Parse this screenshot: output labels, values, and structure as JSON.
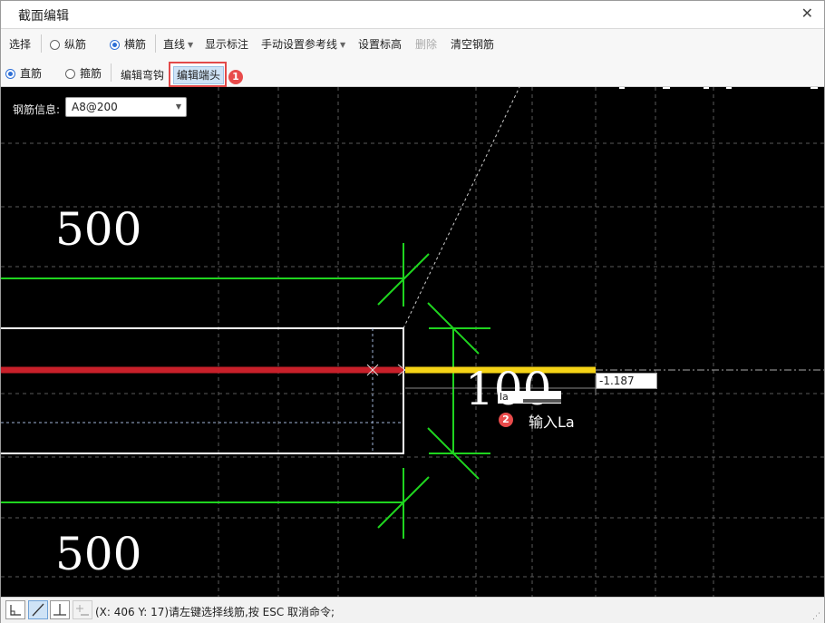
{
  "window": {
    "title": "截面编辑"
  },
  "toolbar1": {
    "select": "选择",
    "longitudinal": "纵筋",
    "transverse": "横筋",
    "line": "直线",
    "show_dims": "显示标注",
    "manual_ref": "手动设置参考线",
    "set_elevation": "设置标高",
    "delete": "删除",
    "clear_rebar": "清空钢筋"
  },
  "toolbar2": {
    "straight": "直筋",
    "stirrup": "箍筋",
    "edit_hook": "编辑弯钩",
    "edit_end": "编辑端头",
    "badge1": "1"
  },
  "canvas": {
    "rebar_info_label": "钢筋信息:",
    "rebar_info_value": "A8@200",
    "dim_top": "500",
    "dim_bottom": "500",
    "dim_mid": "100",
    "length_input": "-1.187",
    "la_input": "la",
    "badge2": "2",
    "hint": "输入La"
  },
  "status": {
    "text": "(X: 406 Y: 17)请左键选择线筋,按 ESC 取消命令;"
  },
  "colors": {
    "canvas_bg": "#000000",
    "dim_green": "#1fd41f",
    "rebar_red": "#c8202a",
    "rebar_yellow": "#f5d316",
    "badge_red": "#e84b4b"
  }
}
